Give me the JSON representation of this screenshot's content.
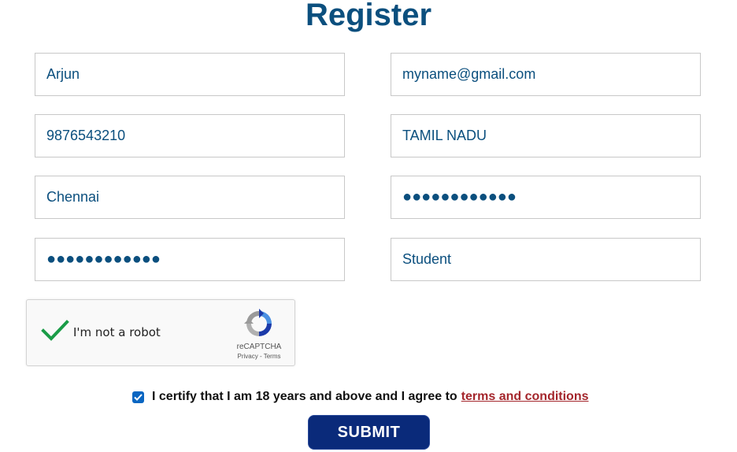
{
  "page": {
    "title": "Register"
  },
  "form": {
    "name": "Arjun",
    "email": "myname@gmail.com",
    "phone": "9876543210",
    "state": "TAMIL NADU",
    "city": "Chennai",
    "password": "●●●●●●●●●●●●",
    "confirm_password": "●●●●●●●●●●●●",
    "role": "Student"
  },
  "captcha": {
    "label": "I'm not a robot",
    "brand": "reCAPTCHA",
    "links": "Privacy - Terms",
    "checked": true,
    "check_color": "#1a9c47"
  },
  "certify": {
    "text": "I certify that I am 18 years and above and I agree to",
    "link": "terms and conditions",
    "checked": true
  },
  "submit": {
    "label": "SUBMIT"
  },
  "colors": {
    "title": "#0b4f7e",
    "field_text": "#0b4f7e",
    "link": "#a4262c",
    "button": "#0a2a7a"
  }
}
